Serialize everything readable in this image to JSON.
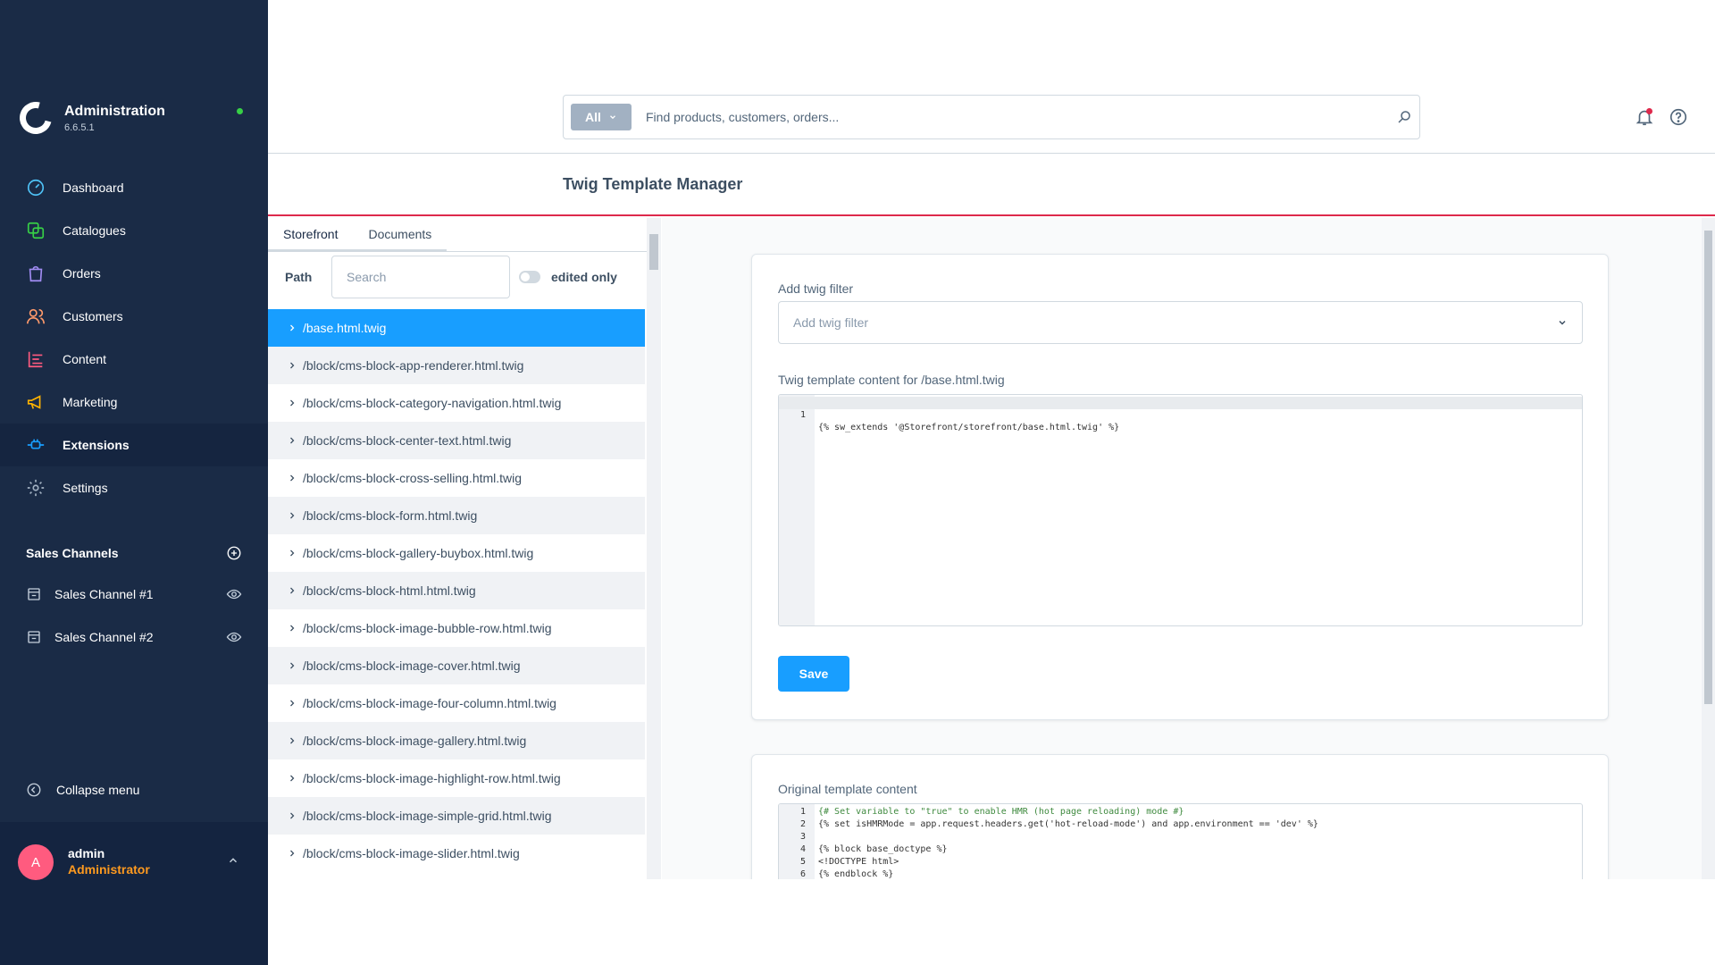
{
  "brand": {
    "title": "Administration",
    "version": "6.6.5.1"
  },
  "nav": [
    {
      "label": "Dashboard",
      "icon": "gauge-icon",
      "color": "#4fc3f7"
    },
    {
      "label": "Catalogues",
      "icon": "catalogue-icon",
      "color": "#37d046"
    },
    {
      "label": "Orders",
      "icon": "shopping-bag-icon",
      "color": "#a18cf2"
    },
    {
      "label": "Customers",
      "icon": "users-icon",
      "color": "#ff9a6b"
    },
    {
      "label": "Content",
      "icon": "content-icon",
      "color": "#ff5b7f"
    },
    {
      "label": "Marketing",
      "icon": "megaphone-icon",
      "color": "#ffb300"
    },
    {
      "label": "Extensions",
      "icon": "plug-icon",
      "color": "#189eff"
    },
    {
      "label": "Settings",
      "icon": "gear-icon",
      "color": "#a2b1c2"
    }
  ],
  "sales_channels": {
    "title": "Sales Channels",
    "items": [
      {
        "label": "Sales Channel #1"
      },
      {
        "label": "Sales Channel #2"
      }
    ]
  },
  "collapse_label": "Collapse menu",
  "user": {
    "initial": "A",
    "name": "admin",
    "role": "Administrator"
  },
  "search": {
    "type": "All",
    "placeholder": "Find products, customers, orders..."
  },
  "page_title": "Twig Template Manager",
  "tabs": [
    "Storefront",
    "Documents"
  ],
  "filter": {
    "label": "Path",
    "placeholder": "Search",
    "toggle_label": "edited only"
  },
  "files": [
    "/base.html.twig",
    "/block/cms-block-app-renderer.html.twig",
    "/block/cms-block-category-navigation.html.twig",
    "/block/cms-block-center-text.html.twig",
    "/block/cms-block-cross-selling.html.twig",
    "/block/cms-block-form.html.twig",
    "/block/cms-block-gallery-buybox.html.twig",
    "/block/cms-block-html.html.twig",
    "/block/cms-block-image-bubble-row.html.twig",
    "/block/cms-block-image-cover.html.twig",
    "/block/cms-block-image-four-column.html.twig",
    "/block/cms-block-image-gallery.html.twig",
    "/block/cms-block-image-highlight-row.html.twig",
    "/block/cms-block-image-simple-grid.html.twig",
    "/block/cms-block-image-slider.html.twig"
  ],
  "editor_card": {
    "filter_label": "Add twig filter",
    "filter_placeholder": "Add twig filter",
    "content_label": "Twig template content for /base.html.twig",
    "line_number": "1",
    "code": "{% sw_extends '@Storefront/storefront/base.html.twig' %}",
    "save_label": "Save"
  },
  "original_card": {
    "label": "Original template content",
    "lines": [
      {
        "n": "1",
        "text": "{# Set variable to \"true\" to enable HMR (hot page reloading) mode #}"
      },
      {
        "n": "2",
        "text": "{% set isHMRMode = app.request.headers.get('hot-reload-mode') and app.environment == 'dev' %}"
      },
      {
        "n": "3",
        "text": ""
      },
      {
        "n": "4",
        "text": "{% block base_doctype %}"
      },
      {
        "n": "5",
        "text": "<!DOCTYPE html>"
      },
      {
        "n": "6",
        "text": "{% endblock %}"
      }
    ]
  }
}
